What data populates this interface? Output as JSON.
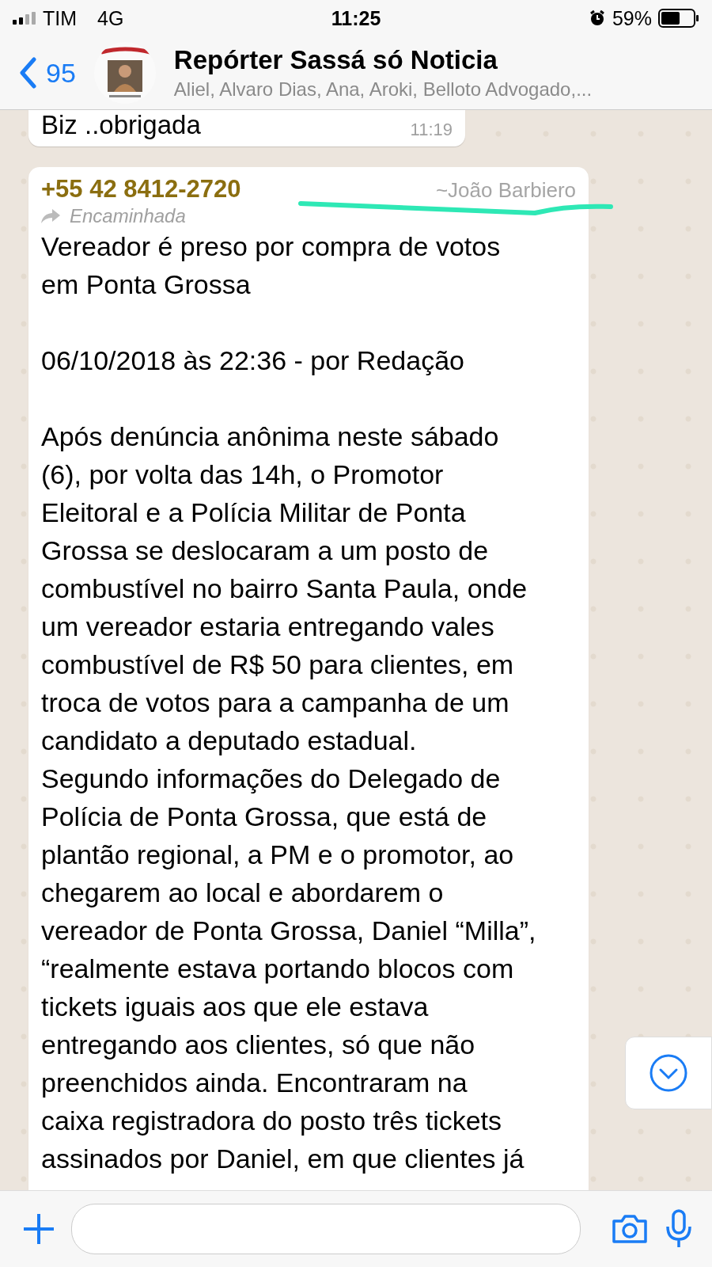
{
  "status_bar": {
    "carrier": "TIM",
    "network": "4G",
    "time": "11:25",
    "battery": "59%"
  },
  "header": {
    "back_count": "95",
    "title": "Repórter Sassá só Noticia",
    "subtitle": "Aliel, Alvaro Dias, Ana, Aroki, Belloto Advogado,..."
  },
  "messages": [
    {
      "kind": "plain",
      "text": "Biz ..obrigada",
      "time": "11:19"
    },
    {
      "kind": "forwarded",
      "sender_phone": "+55 42 8412-2720",
      "sender_name": "~João Barbiero",
      "forwarded_label": "Encaminhada",
      "paragraphs": [
        [
          "Vereador é preso por compra de votos",
          "em Ponta Grossa"
        ],
        [
          "06/10/2018 às 22:36 - por Redação"
        ],
        [
          "Após denúncia anônima neste sábado",
          "(6), por volta das 14h, o Promotor",
          "Eleitoral e a Polícia Militar de Ponta",
          "Grossa se deslocaram a um posto de",
          "combustível no bairro Santa Paula, onde",
          "um vereador estaria entregando vales",
          "combustível de R$ 50 para clientes, em",
          "troca de votos para a campanha de um",
          "candidato a deputado estadual.",
          "Segundo informações do Delegado de",
          "Polícia de Ponta Grossa, que está de",
          "plantão regional, a PM e o promotor, ao",
          "chegarem ao local e abordarem o",
          "vereador de Ponta Grossa, Daniel “Milla”,",
          "“realmente estava portando blocos com",
          "tickets iguais aos que ele estava",
          "entregando aos clientes, só que não",
          "preenchidos ainda. Encontraram na",
          "caixa registradora do posto três tickets",
          "assinados por Daniel, em que clientes já"
        ]
      ]
    }
  ]
}
